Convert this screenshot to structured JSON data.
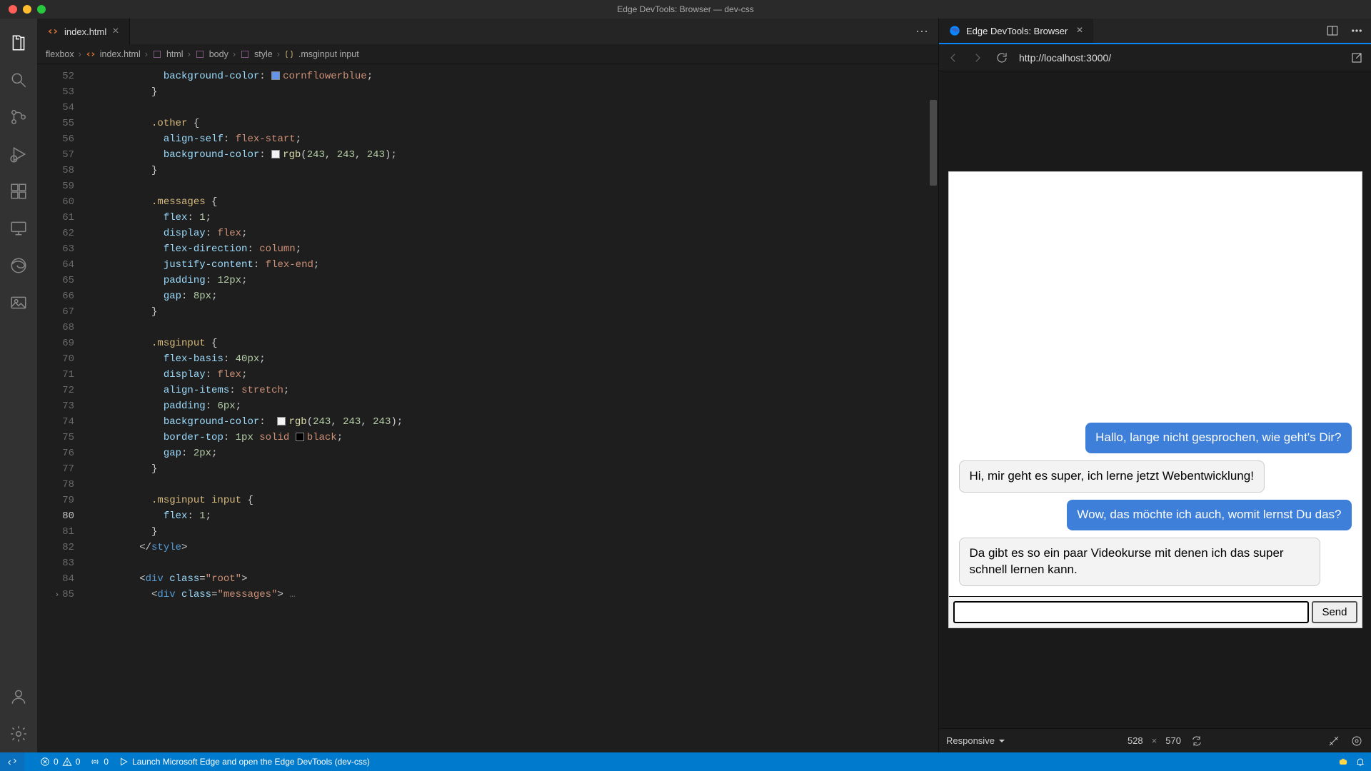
{
  "window": {
    "title": "Edge DevTools: Browser — dev-css"
  },
  "editor_tab": {
    "filename": "index.html"
  },
  "breadcrumbs": {
    "root": "flexbox",
    "file": "index.html",
    "path": [
      "html",
      "body",
      "style",
      ".msginput input"
    ]
  },
  "code_lines": [
    {
      "n": 52,
      "html": "            <span class='tok-prop'>background-color</span><span class='tok-punct'>:</span> <span class='swatch' style='background:#6495ed'></span><span class='tok-valkw'>cornflowerblue</span><span class='tok-punct'>;</span>"
    },
    {
      "n": 53,
      "html": "          <span class='tok-punct'>}</span>"
    },
    {
      "n": 54,
      "html": ""
    },
    {
      "n": 55,
      "html": "          <span class='tok-sel'>.other</span> <span class='tok-punct'>{</span>"
    },
    {
      "n": 56,
      "html": "            <span class='tok-prop'>align-self</span><span class='tok-punct'>:</span> <span class='tok-valkw'>flex-start</span><span class='tok-punct'>;</span>"
    },
    {
      "n": 57,
      "html": "            <span class='tok-prop'>background-color</span><span class='tok-punct'>:</span> <span class='swatch' style='background:#f3f3f3'></span><span class='tok-func'>rgb</span><span class='tok-punct'>(</span><span class='tok-num'>243</span><span class='tok-punct'>,</span> <span class='tok-num'>243</span><span class='tok-punct'>,</span> <span class='tok-num'>243</span><span class='tok-punct'>);</span>"
    },
    {
      "n": 58,
      "html": "          <span class='tok-punct'>}</span>"
    },
    {
      "n": 59,
      "html": ""
    },
    {
      "n": 60,
      "html": "          <span class='tok-sel'>.messages</span> <span class='tok-punct'>{</span>"
    },
    {
      "n": 61,
      "html": "            <span class='tok-prop'>flex</span><span class='tok-punct'>:</span> <span class='tok-num'>1</span><span class='tok-punct'>;</span>"
    },
    {
      "n": 62,
      "html": "            <span class='tok-prop'>display</span><span class='tok-punct'>:</span> <span class='tok-valkw'>flex</span><span class='tok-punct'>;</span>"
    },
    {
      "n": 63,
      "html": "            <span class='tok-prop'>flex-direction</span><span class='tok-punct'>:</span> <span class='tok-valkw'>column</span><span class='tok-punct'>;</span>"
    },
    {
      "n": 64,
      "html": "            <span class='tok-prop'>justify-content</span><span class='tok-punct'>:</span> <span class='tok-valkw'>flex-end</span><span class='tok-punct'>;</span>"
    },
    {
      "n": 65,
      "html": "            <span class='tok-prop'>padding</span><span class='tok-punct'>:</span> <span class='tok-num'>12px</span><span class='tok-punct'>;</span>"
    },
    {
      "n": 66,
      "html": "            <span class='tok-prop'>gap</span><span class='tok-punct'>:</span> <span class='tok-num'>8px</span><span class='tok-punct'>;</span>"
    },
    {
      "n": 67,
      "html": "          <span class='tok-punct'>}</span>"
    },
    {
      "n": 68,
      "html": ""
    },
    {
      "n": 69,
      "html": "          <span class='tok-sel'>.msginput</span> <span class='tok-punct'>{</span>"
    },
    {
      "n": 70,
      "html": "            <span class='tok-prop'>flex-basis</span><span class='tok-punct'>:</span> <span class='tok-num'>40px</span><span class='tok-punct'>;</span>"
    },
    {
      "n": 71,
      "html": "            <span class='tok-prop'>display</span><span class='tok-punct'>:</span> <span class='tok-valkw'>flex</span><span class='tok-punct'>;</span>"
    },
    {
      "n": 72,
      "html": "            <span class='tok-prop'>align-items</span><span class='tok-punct'>:</span> <span class='tok-valkw'>stretch</span><span class='tok-punct'>;</span>"
    },
    {
      "n": 73,
      "html": "            <span class='tok-prop'>padding</span><span class='tok-punct'>:</span> <span class='tok-num'>6px</span><span class='tok-punct'>;</span>"
    },
    {
      "n": 74,
      "html": "            <span class='tok-prop'>background-color</span><span class='tok-punct'>:</span>  <span class='swatch' style='background:#f3f3f3'></span><span class='tok-func'>rgb</span><span class='tok-punct'>(</span><span class='tok-num'>243</span><span class='tok-punct'>,</span> <span class='tok-num'>243</span><span class='tok-punct'>,</span> <span class='tok-num'>243</span><span class='tok-punct'>);</span>"
    },
    {
      "n": 75,
      "html": "            <span class='tok-prop'>border-top</span><span class='tok-punct'>:</span> <span class='tok-num'>1px</span> <span class='tok-valkw'>solid</span> <span class='swatch' style='background:#000'></span><span class='tok-valkw'>black</span><span class='tok-punct'>;</span>"
    },
    {
      "n": 76,
      "html": "            <span class='tok-prop'>gap</span><span class='tok-punct'>:</span> <span class='tok-num'>2px</span><span class='tok-punct'>;</span>"
    },
    {
      "n": 77,
      "html": "          <span class='tok-punct'>}</span>"
    },
    {
      "n": 78,
      "html": ""
    },
    {
      "n": 79,
      "html": "          <span class='tok-sel'>.msginput input</span> <span class='tok-punct'>{</span>"
    },
    {
      "n": 80,
      "html": "            <span class='tok-prop'>flex</span><span class='tok-punct'>:</span> <span class='tok-num'>1</span><span class='tok-punct'>;</span>",
      "active": true
    },
    {
      "n": 81,
      "html": "          <span class='tok-punct'>}</span>"
    },
    {
      "n": 82,
      "html": "        <span class='tok-punct'>&lt;/</span><span class='tok-tag'>style</span><span class='tok-punct'>&gt;</span>"
    },
    {
      "n": 83,
      "html": ""
    },
    {
      "n": 84,
      "html": "        <span class='tok-punct'>&lt;</span><span class='tok-tag'>div</span> <span class='tok-attr'>class</span><span class='tok-punct'>=</span><span class='tok-str'>\"root\"</span><span class='tok-punct'>&gt;</span>"
    },
    {
      "n": 85,
      "html": "          <span class='tok-punct'>&lt;</span><span class='tok-tag'>div</span> <span class='tok-attr'>class</span><span class='tok-punct'>=</span><span class='tok-str'>\"messages\"</span><span class='tok-punct'>&gt;</span><span class='tok-punct' style='color:#666'> …</span>",
      "fold": true
    }
  ],
  "browser_panel": {
    "tab_title": "Edge DevTools: Browser",
    "url": "http://localhost:3000/"
  },
  "chat": {
    "messages": [
      {
        "who": "me",
        "text": "Hallo, lange nicht gesprochen, wie geht's Dir?"
      },
      {
        "who": "other",
        "text": "Hi, mir geht es super, ich lerne jetzt Webentwicklung!"
      },
      {
        "who": "me",
        "text": "Wow, das möchte ich auch, womit lernst Du das?"
      },
      {
        "who": "other",
        "text": "Da gibt es so ein paar Videokurse mit denen ich das super schnell lernen kann."
      }
    ],
    "send_label": "Send",
    "input_value": ""
  },
  "devtoolbar": {
    "device": "Responsive",
    "width": "528",
    "sep": "×",
    "height": "570"
  },
  "status": {
    "errors": "0",
    "warnings": "0",
    "ports": "0",
    "launch": "Launch Microsoft Edge and open the Edge DevTools (dev-css)"
  }
}
